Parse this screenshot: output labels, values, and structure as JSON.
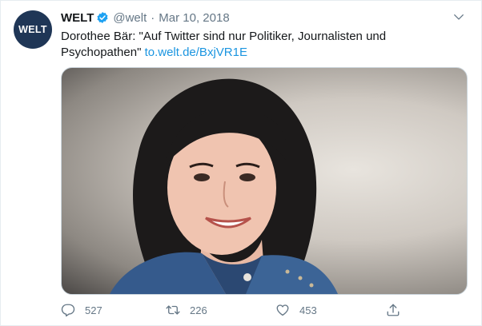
{
  "author": {
    "avatar_text": "WELT",
    "display_name": "WELT",
    "handle": "@welt",
    "separator": "·",
    "date": "Mar 10, 2018",
    "verified": true
  },
  "tweet": {
    "text": "Dorothee Bär: \"Auf Twitter sind nur Politiker, Journalisten und Psychopathen\" ",
    "link": "to.welt.de/BxjVR1E"
  },
  "actions": {
    "reply_count": "527",
    "retweet_count": "226",
    "like_count": "453"
  },
  "colors": {
    "accent": "#1b95e0",
    "verified": "#1da1f2",
    "muted": "#657786",
    "avatar_bg": "#1f3656"
  },
  "icons": {
    "menu": "chevron-down-icon",
    "verified": "verified-badge-icon",
    "reply": "reply-icon",
    "retweet": "retweet-icon",
    "like": "heart-icon",
    "share": "share-icon"
  }
}
